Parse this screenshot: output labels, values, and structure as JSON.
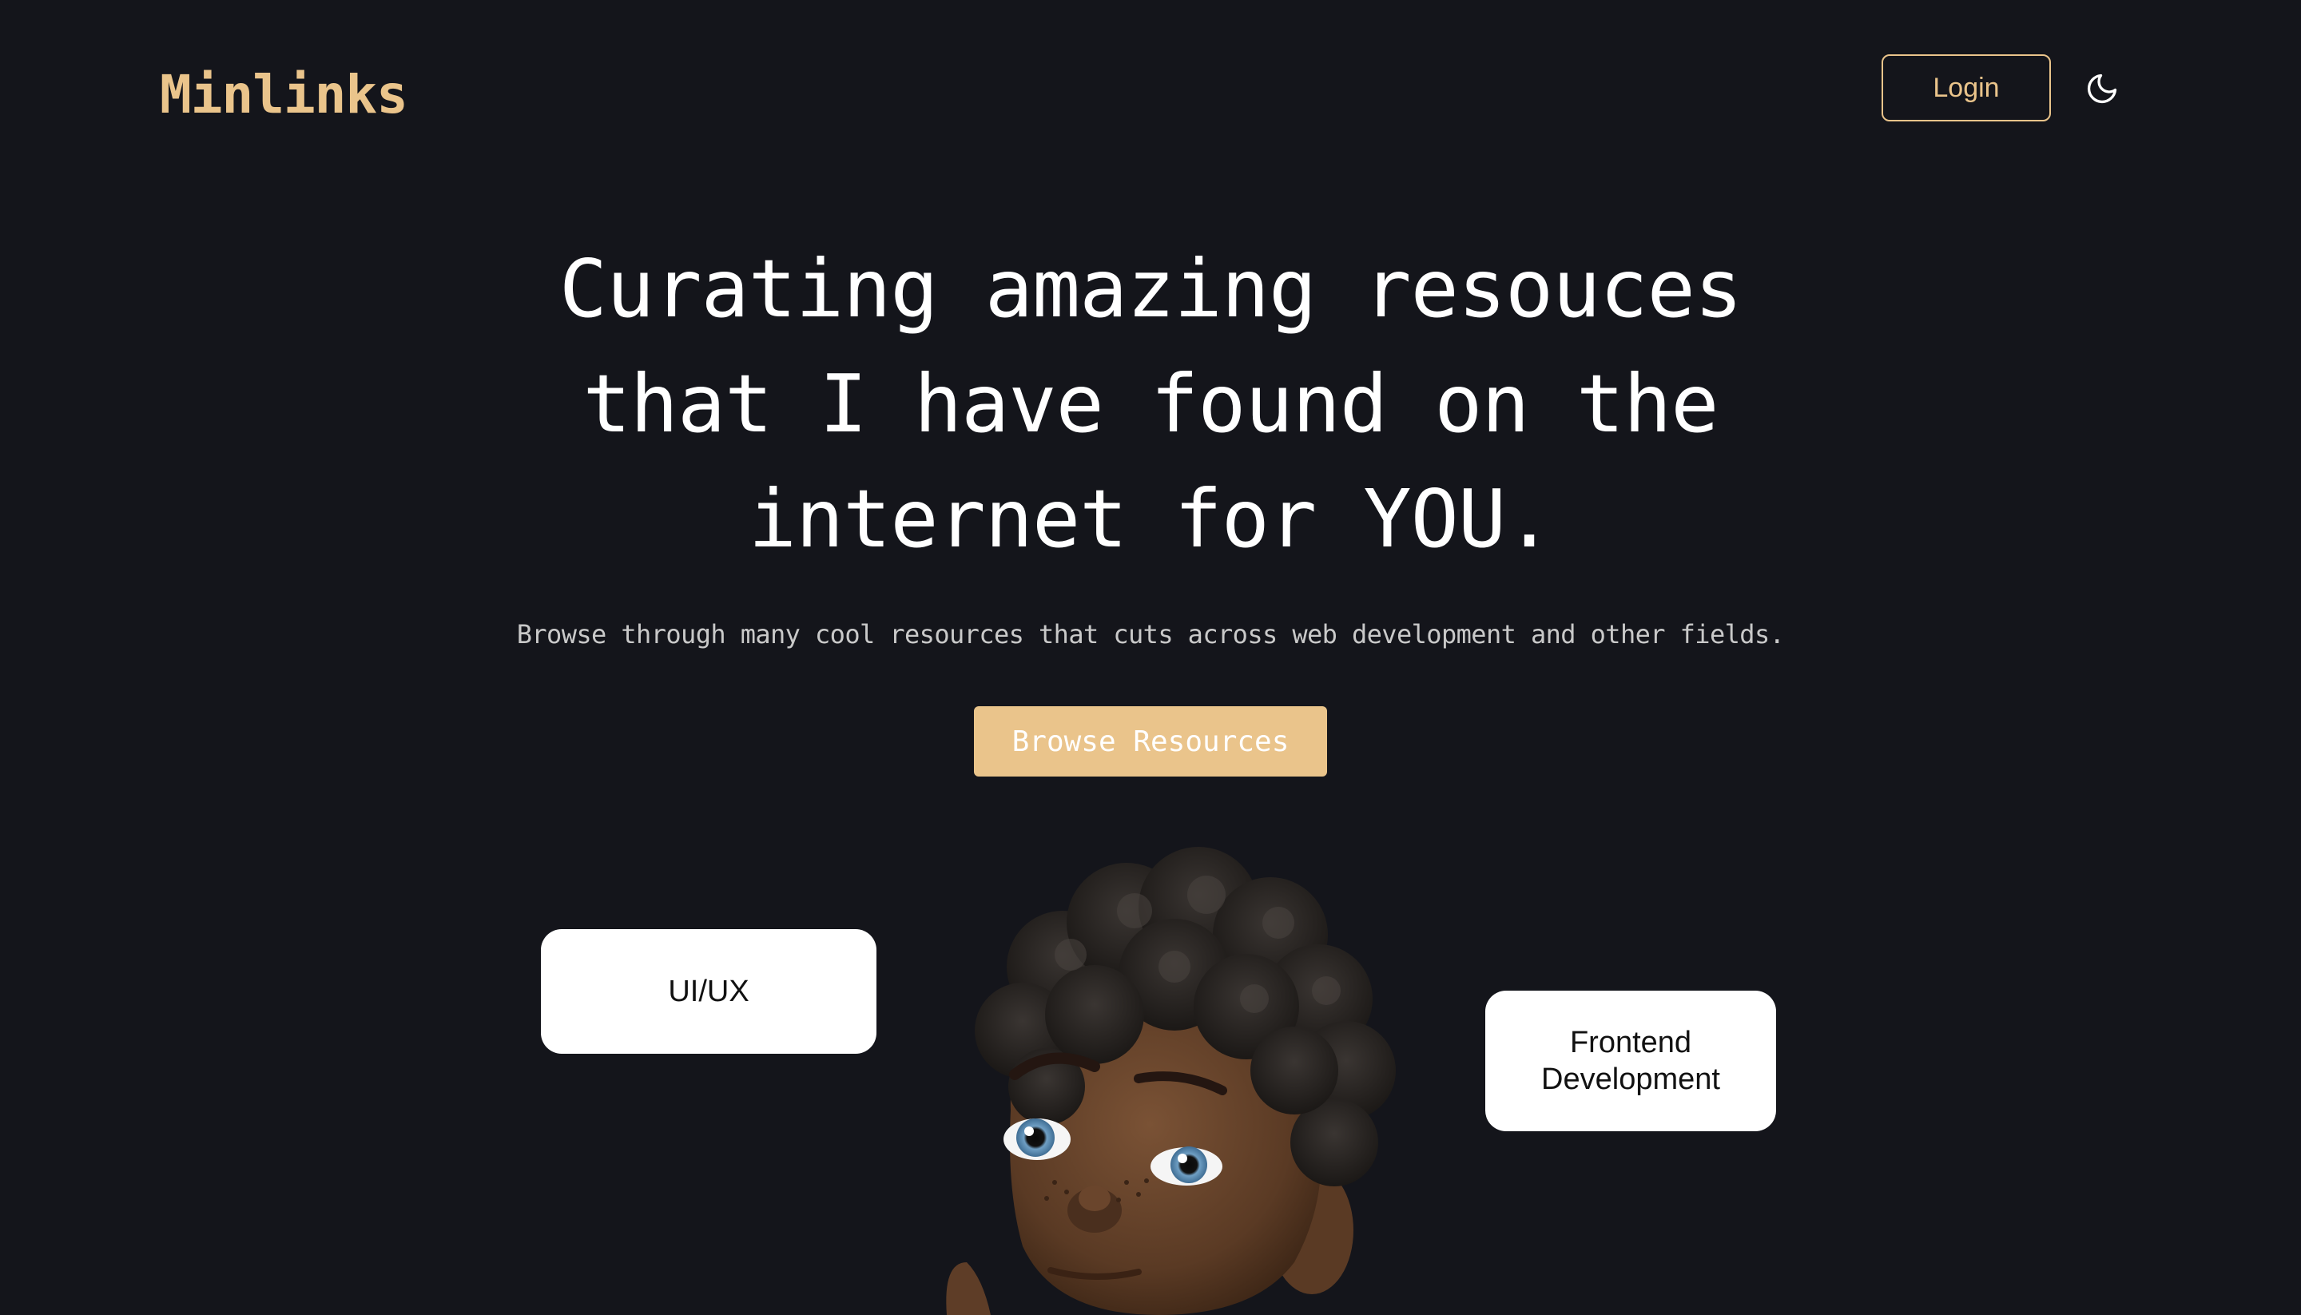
{
  "header": {
    "logo_text": "Minlinks",
    "login_label": "Login",
    "theme_icon": "moon-icon"
  },
  "hero": {
    "title_lines": [
      "Curating amazing resouces",
      "that I have found on the",
      "internet for YOU."
    ],
    "subtitle": "Browse through many cool resources that cuts across web development and other fields.",
    "cta_label": "Browse Resources"
  },
  "tags": {
    "uiux": "UI/UX",
    "frontend_lines": [
      "Frontend",
      "Development"
    ]
  },
  "illustration": {
    "icon": "memoji-avatar-icon"
  },
  "colors": {
    "background": "#14151b",
    "accent": "#eac48b",
    "text": "#ffffff",
    "muted_text": "#c9c9c9",
    "card": "#ffffff"
  }
}
